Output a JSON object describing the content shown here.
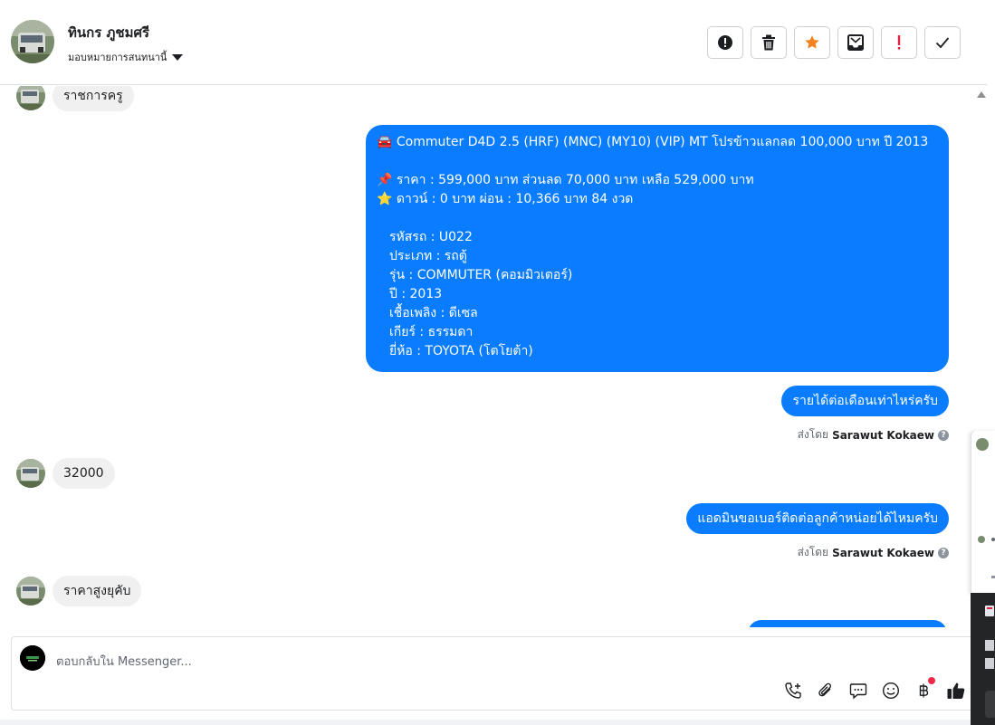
{
  "header": {
    "name": "ทินกร ภูชมศรี",
    "assign_label": "มอบหมายการสนทนานี้"
  },
  "toolbar": {
    "buttons": [
      {
        "icon": "alert-circle-icon",
        "color": "#1c1e21"
      },
      {
        "icon": "trash-icon",
        "color": "#1c1e21"
      },
      {
        "icon": "star-icon",
        "color": "#f5821f"
      },
      {
        "icon": "archive-inbox-icon",
        "color": "#1c1e21"
      },
      {
        "icon": "exclamation-icon",
        "color": "#e41e3f"
      },
      {
        "icon": "checkmark-icon",
        "color": "#1c1e21"
      }
    ]
  },
  "messages": {
    "m1": "ราชการครู",
    "car": {
      "title_emoji": "🚘",
      "title": "Commuter D4D 2.5 (HRF) (MNC) (MY10) (VIP) MT โปรข้าวแลกลด 100,000 บาท ปี 2013",
      "price_emoji": "📌",
      "price": "ราคา : 599,000 บาท ส่วนลด 70,000 บาท เหลือ 529,000 บาท",
      "down_emoji": "⭐",
      "down": "ดาวน์ : 0 บาท ผ่อน : 10,366 บาท 84 งวด",
      "details": [
        "รหัสรถ : U022",
        "ประเภท : รถตู้",
        "รุ่น : COMMUTER (คอมมิวเตอร์)",
        "ปี : 2013",
        "เชื้อเพลิง : ดีเซล",
        "เกียร์ : ธรรมดา",
        "ยี่ห้อ : TOYOTA (โตโยต้า)"
      ]
    },
    "m3": "รายได้ต่อเดือนเท่าไหร่ครับ",
    "sent_by_prefix": "ส่งโดย",
    "sent_by_name": "Sarawut Kokaew",
    "m4": "32000",
    "m5": "แอดมินขอเบอร์ติดต่อลูกค้าหน่อยได้ไหมครับ",
    "m6": "ราคาสูงยุคับ"
  },
  "composer": {
    "placeholder": "ตอบกลับใน Messenger...",
    "tools": [
      "phone-plus-icon",
      "paperclip-icon",
      "chat-bubble-icon",
      "smiley-icon",
      "baht-icon",
      "thumbs-up-icon"
    ]
  },
  "colors": {
    "outgoing": "#0a7cff",
    "incoming": "#f0f0f0",
    "accent_orange": "#f5821f",
    "alert_red": "#e41e3f"
  }
}
